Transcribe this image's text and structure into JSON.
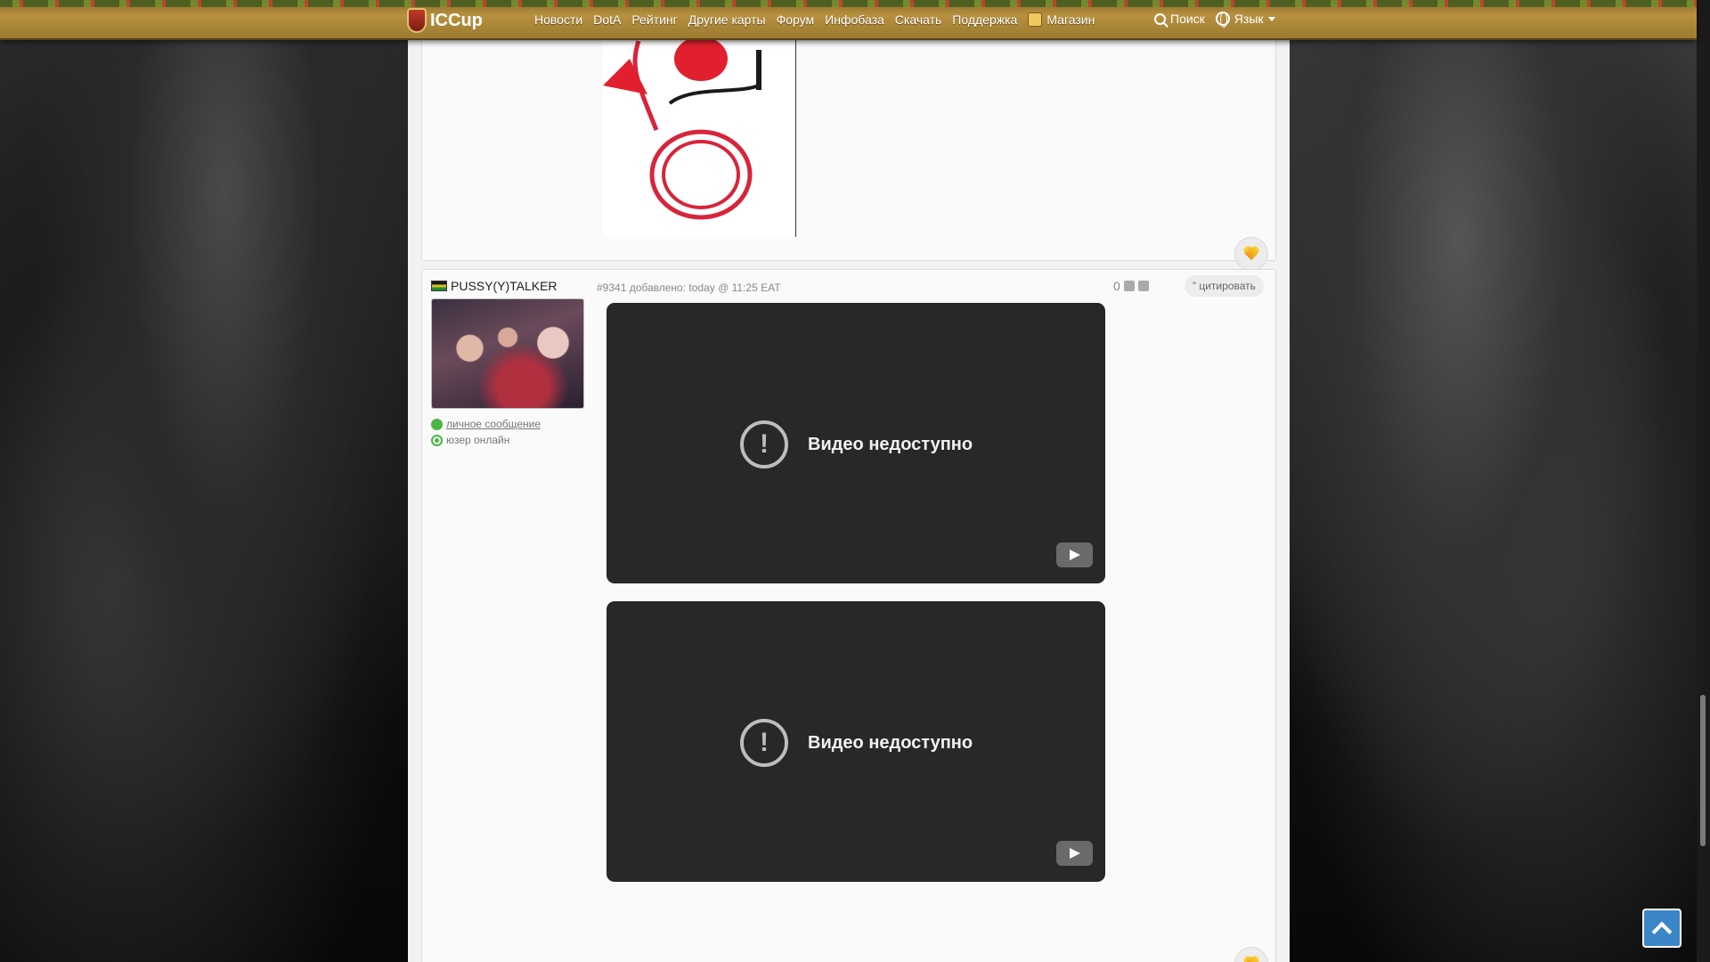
{
  "header": {
    "logo_text": "ICCup",
    "nav": [
      "Новости",
      "DotA",
      "Рейтинг",
      "Другие карты",
      "Форум",
      "Инфобаза",
      "Скачать",
      "Поддержка"
    ],
    "shop_label": "Магазин",
    "search_label": "Поиск",
    "language_label": "Язык"
  },
  "post": {
    "author": "PUSSY(Y)TALKER",
    "private_message": "личное сообщение",
    "status": "юзер онлайн",
    "meta": "#9341 добавлено: today @ 11:25 EAT",
    "vote_count": "0",
    "quote_label": "цитировать",
    "videos": [
      {
        "message": "Видео недоступно"
      },
      {
        "message": "Видео недоступно"
      }
    ]
  },
  "colors": {
    "topbar": "#b8913f",
    "content_bg": "#f2f2f2",
    "video_bg": "#282828",
    "online_green": "#4bb543",
    "to_top_blue": "#3b86c6"
  }
}
